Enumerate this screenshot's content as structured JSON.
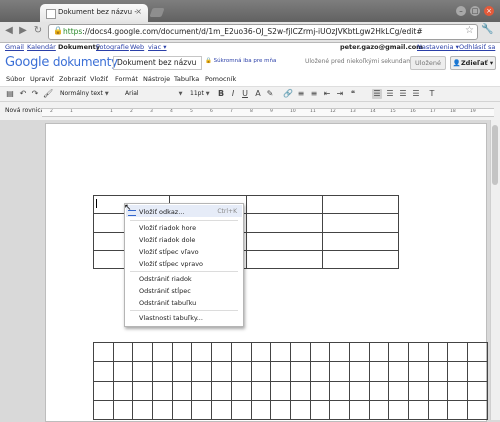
{
  "browser": {
    "tab_title": "Dokument bez názvu -",
    "tab_close": "×",
    "url_scheme": "https",
    "url_rest": "://docs4.google.com/document/d/1m_E2uo36-OJ_S2w-fjlCZrmj-iUOzJVKbtLgw2HkLCg/edit#",
    "star": "☆"
  },
  "gbar": {
    "links": [
      "Gmail",
      "Kalendár",
      "Dokumenty",
      "Fotografie",
      "Web",
      "viac ▾"
    ],
    "user": "peter.gazo@gmail.com",
    "settings": "Nastavenia ▾",
    "logout": "Odhlásiť sa"
  },
  "header": {
    "logo_google": "Google",
    "logo_product": "dokumenty",
    "doc_name": "Dokument bez názvu",
    "private_label": "Súkromná iba pre mňa",
    "saved_status": "Uložené pred niekoľkými sekundami",
    "save_button": "Uložené",
    "share_button": "Zdieľať ▾"
  },
  "menubar": [
    "Súbor",
    "Upraviť",
    "Zobraziť",
    "Vložiť",
    "Formát",
    "Nástroje",
    "Tabuľka",
    "Pomocník"
  ],
  "toolbar": {
    "style_select": "Normálny text",
    "font_select": "Arial",
    "size_select": "11pt"
  },
  "subbar": {
    "new_row": "Nová rovnica",
    "ruler_ticks": [
      "2",
      "1",
      "",
      "1",
      "2",
      "3",
      "4",
      "5",
      "6",
      "7",
      "8",
      "9",
      "10",
      "11",
      "12",
      "13",
      "14",
      "15",
      "16",
      "17",
      "18",
      "19"
    ]
  },
  "context_menu": {
    "items": [
      {
        "label": "Vložiť odkaz...",
        "shortcut": "Ctrl+K"
      },
      {
        "label": "Vložiť riadok hore"
      },
      {
        "label": "Vložiť riadok dole"
      },
      {
        "label": "Vložiť stĺpec vľavo"
      },
      {
        "label": "Vložiť stĺpec vpravo"
      },
      {
        "label": "Odstrániť riadok"
      },
      {
        "label": "Odstrániť stĺpec"
      },
      {
        "label": "Odstrániť tabuľku"
      },
      {
        "label": "Vlastnosti tabuľky..."
      }
    ]
  },
  "icons": {
    "back": "back-arrow-icon",
    "forward": "forward-arrow-icon",
    "reload": "reload-icon",
    "lock": "lock-icon",
    "wrench": "wrench-icon",
    "link": "link-icon",
    "cursor": "mouse-cursor-icon"
  }
}
